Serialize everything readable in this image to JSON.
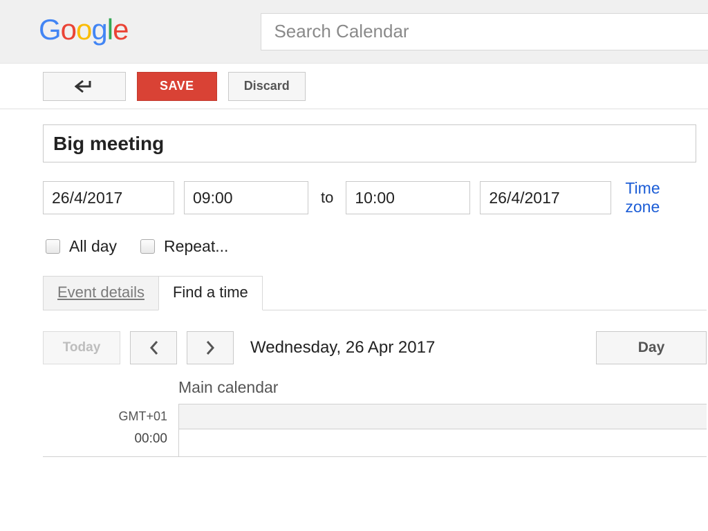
{
  "header": {
    "logo_text": "Google",
    "search_placeholder": "Search Calendar"
  },
  "actions": {
    "save_label": "SAVE",
    "discard_label": "Discard"
  },
  "event": {
    "title": "Big meeting",
    "start_date": "26/4/2017",
    "start_time": "09:00",
    "end_time": "10:00",
    "end_date": "26/4/2017",
    "to_label": "to",
    "timezone_link": "Time zone",
    "all_day_label": "All day",
    "repeat_label": "Repeat..."
  },
  "tabs": {
    "details_label": "Event details",
    "findtime_label": "Find a time"
  },
  "scheduler": {
    "today_label": "Today",
    "date_label": "Wednesday, 26 Apr 2017",
    "view_label": "Day",
    "calendar_name": "Main calendar",
    "timezone_label": "GMT+01",
    "first_slot": "00:00"
  }
}
